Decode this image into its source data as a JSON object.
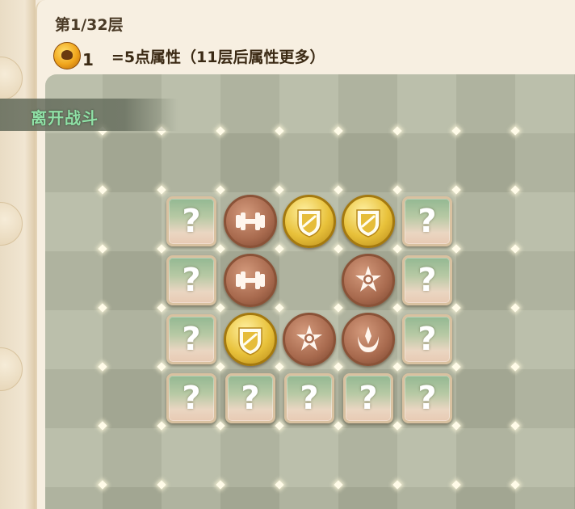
{
  "header": {
    "floor_title": "第1/32层",
    "coin_count": "1",
    "attr_text": "=5点属性（11层后属性更多）"
  },
  "leave_button": {
    "label": "离开战斗"
  },
  "board": {
    "rows": 4,
    "cols": 5,
    "cells": [
      [
        "question",
        "dumbbell",
        "shield",
        "shield",
        "question"
      ],
      [
        "question",
        "dumbbell",
        "empty",
        "star",
        "question"
      ],
      [
        "question",
        "shield",
        "star",
        "crescent",
        "question"
      ],
      [
        "question",
        "question",
        "question",
        "question",
        "question"
      ]
    ],
    "question_label": "?"
  },
  "colors": {
    "orb_brown": "#a86a4e",
    "orb_gold": "#e8c13a",
    "leave_label": "#8fe0a6"
  }
}
